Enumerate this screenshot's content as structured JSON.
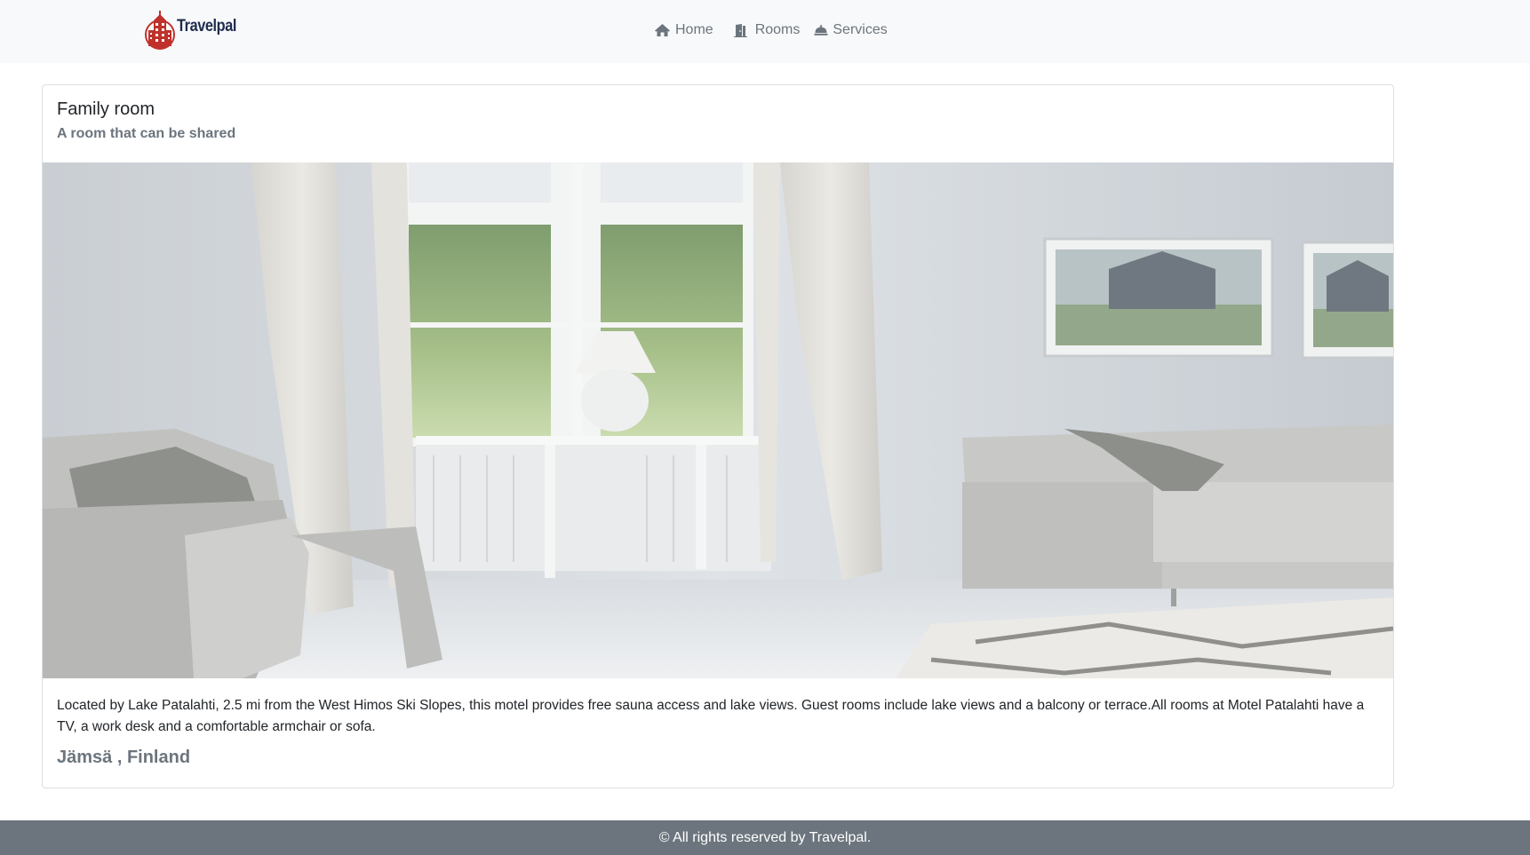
{
  "navbar": {
    "brand_name": "Travelpal",
    "brand_logo_icon": "hotel-building-logo",
    "items": [
      {
        "label": "Home",
        "icon": "home-icon"
      },
      {
        "label": "Rooms",
        "icon": "door-icon"
      },
      {
        "label": "Services",
        "icon": "bell-icon"
      }
    ]
  },
  "card": {
    "title": "Family room",
    "subtitle": "A room that can be shared",
    "image_icon": "room-photo",
    "description": "Located by Lake Patalahti, 2.5 mi from the West Himos Ski Slopes, this motel provides free sauna access and lake views. Guest rooms include lake views and a balcony or terrace.All rooms at Motel Patalahti have a TV, a work desk and a comfortable armchair or sofa.",
    "location": "Jämsä , Finland"
  },
  "footer": {
    "text": "© All rights reserved by Travelpal."
  },
  "colors": {
    "navbar_bg": "#f8f9fa",
    "muted_text": "#6c757d",
    "footer_bg": "#6c757d",
    "logo_red": "#c0312b",
    "brand_navy": "#1f2b4d"
  }
}
